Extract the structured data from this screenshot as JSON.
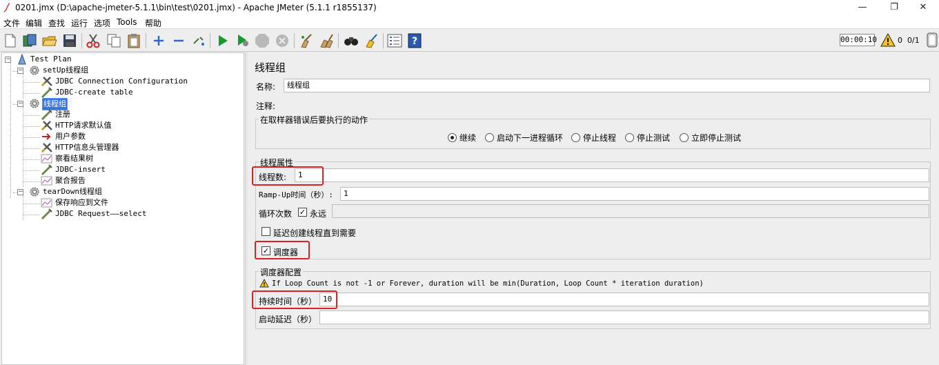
{
  "window": {
    "title": "0201.jmx (D:\\apache-jmeter-5.1.1\\bin\\test\\0201.jmx) - Apache JMeter (5.1.1 r1855137)",
    "minimize": "—",
    "maximize": "❐",
    "close": "✕"
  },
  "menu": [
    "文件",
    "编辑",
    "查找",
    "运行",
    "选项",
    "Tools",
    "帮助"
  ],
  "toolbar": {
    "timer": "00:00:10",
    "error_count": "0",
    "thread_count": "0/1",
    "icons": [
      "new-icon",
      "templates-icon",
      "open-icon",
      "save-icon",
      "cut-icon",
      "copy-icon",
      "paste-icon",
      "expand-icon",
      "collapse-icon",
      "toggle-icon",
      "start-icon",
      "start-no-pause-icon",
      "stop-icon",
      "shutdown-icon",
      "clear-icon",
      "clear-all-icon",
      "search-icon",
      "reset-search-icon",
      "function-helper-icon",
      "help-icon"
    ]
  },
  "tree": {
    "nodes": [
      {
        "label": "Test Plan",
        "icon": "test-plan-icon",
        "level": 0
      },
      {
        "label": "setUp线程组",
        "icon": "gear-icon",
        "level": 1
      },
      {
        "label": "JDBC Connection Configuration",
        "icon": "config-icon",
        "level": 2
      },
      {
        "label": "JDBC-create table",
        "icon": "sampler-icon",
        "level": 2
      },
      {
        "label": "线程组",
        "icon": "gear-icon",
        "level": 1,
        "selected": true
      },
      {
        "label": "注册",
        "icon": "sampler-icon",
        "level": 2
      },
      {
        "label": "HTTP请求默认值",
        "icon": "config-icon",
        "level": 2
      },
      {
        "label": "用户参数",
        "icon": "preprocessor-icon",
        "level": 2
      },
      {
        "label": "HTTP信息头管理器",
        "icon": "config-icon",
        "level": 2
      },
      {
        "label": "察看结果树",
        "icon": "listener-icon",
        "level": 2
      },
      {
        "label": "JDBC-insert",
        "icon": "sampler-icon",
        "level": 2
      },
      {
        "label": "聚合报告",
        "icon": "listener-icon",
        "level": 2
      },
      {
        "label": "tearDown线程组",
        "icon": "gear-icon",
        "level": 1
      },
      {
        "label": "保存响应到文件",
        "icon": "listener-icon",
        "level": 2
      },
      {
        "label": "JDBC Request——select",
        "icon": "sampler-icon",
        "level": 2
      }
    ]
  },
  "panel": {
    "title": "线程组",
    "name_label": "名称:",
    "name_value": "线程组",
    "comment_label": "注释:",
    "comment_value": "",
    "on_error": {
      "title": "在取样器错误后要执行的动作",
      "options": [
        "继续",
        "启动下一进程循环",
        "停止线程",
        "停止测试",
        "立即停止测试"
      ],
      "selected": "继续"
    },
    "thread_props": {
      "title": "线程属性",
      "threads_label": "线程数:",
      "threads_value": "1",
      "rampup_label": "Ramp-Up时间（秒）:",
      "rampup_value": "1",
      "loop_label": "循环次数",
      "forever_label": "永远",
      "forever_checked": true,
      "loop_value": "",
      "delay_label": "延迟创建线程直到需要",
      "delay_checked": false,
      "scheduler_label": "调度器",
      "scheduler_checked": true
    },
    "scheduler": {
      "title": "调度器配置",
      "warning": "If Loop Count is not -1 or Forever, duration will be min(Duration, Loop Count * iteration duration)",
      "duration_label": "持续时间（秒）",
      "duration_value": "10",
      "startup_delay_label": "启动延迟（秒）",
      "startup_delay_value": ""
    }
  },
  "colors": {
    "highlight_box": "#e02020",
    "selection": "#3875d7"
  }
}
